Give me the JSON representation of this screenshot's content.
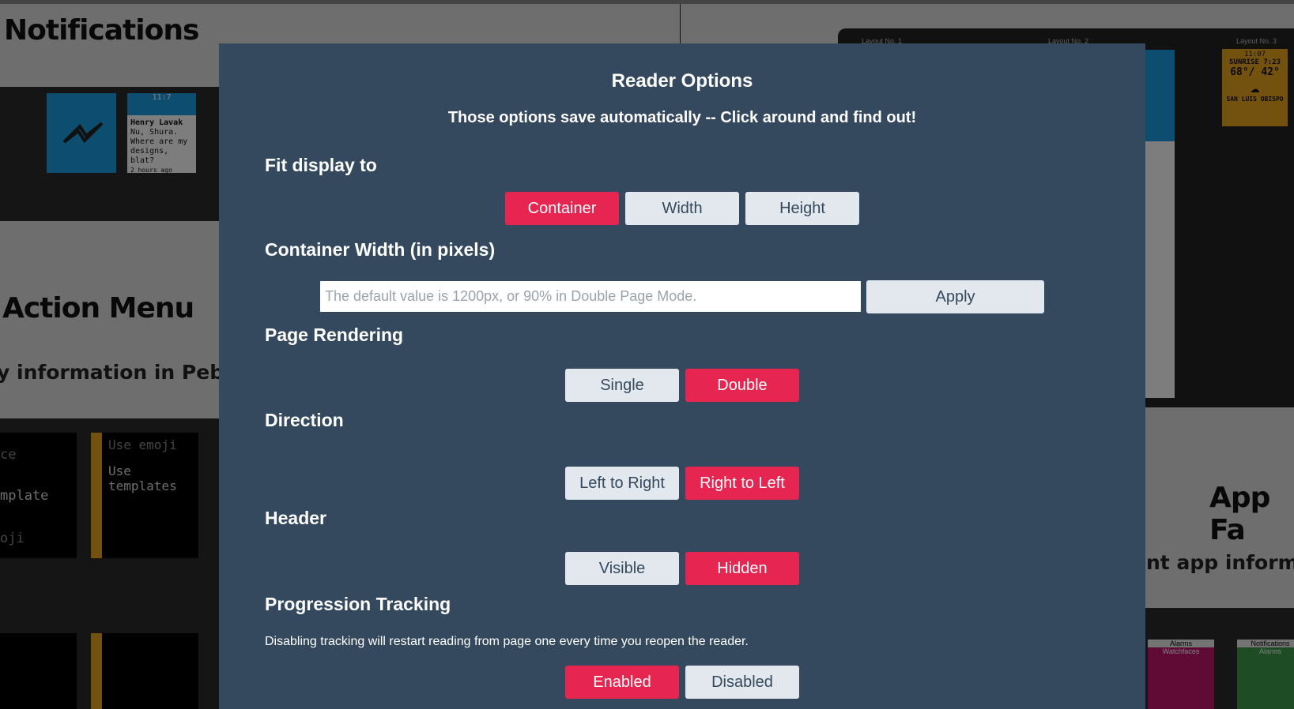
{
  "background": {
    "titles": {
      "notifications": "Notifications",
      "action_menu": "Action Menu",
      "info_fragment": "y information in Pebble",
      "app_fa": "App Fa",
      "app_info_fragment": "nt app informat"
    },
    "notification_tile": {
      "time": "11:7",
      "lines": [
        "Henry Lavak",
        "Nu, Shura.",
        "Where are my",
        "designs, blat?",
        "2 hours ago"
      ]
    },
    "menu_tile_left": [
      "ce",
      "mplate",
      "oji"
    ],
    "menu_tile_right": [
      "Use emoji",
      "Use",
      "templates"
    ],
    "layout_labels": [
      "Layout No. 1",
      "Layout No. 2",
      "Layout No. 3"
    ],
    "weather": {
      "time": "11:07",
      "sunrise": "SUNRISE 7:23",
      "temps": "68°/ 42°",
      "city": "SAN LUIS OBISPO"
    },
    "watch_labels": [
      "Alarms",
      "Watchfaces",
      "Notifications",
      "Alarms"
    ]
  },
  "modal": {
    "title": "Reader Options",
    "subtitle": "Those options save automatically -- Click around and find out!",
    "fit": {
      "heading": "Fit display to",
      "options": [
        "Container",
        "Width",
        "Height"
      ],
      "selected": "Container"
    },
    "container_width": {
      "heading": "Container Width (in pixels)",
      "placeholder": "The default value is 1200px, or 90% in Double Page Mode.",
      "value": "",
      "apply_label": "Apply"
    },
    "rendering": {
      "heading": "Page Rendering",
      "options": [
        "Single",
        "Double"
      ],
      "selected": "Double"
    },
    "direction": {
      "heading": "Direction",
      "options": [
        "Left to Right",
        "Right to Left"
      ],
      "selected": "Right to Left"
    },
    "header": {
      "heading": "Header",
      "options": [
        "Visible",
        "Hidden"
      ],
      "selected": "Hidden"
    },
    "tracking": {
      "heading": "Progression Tracking",
      "description": "Disabling tracking will restart reading from page one every time you reopen the reader.",
      "options": [
        "Enabled",
        "Disabled"
      ],
      "selected": "Enabled"
    }
  },
  "colors": {
    "modal_bg": "#35495e",
    "accent": "#e72551",
    "button_bg": "#e2e8ed"
  }
}
